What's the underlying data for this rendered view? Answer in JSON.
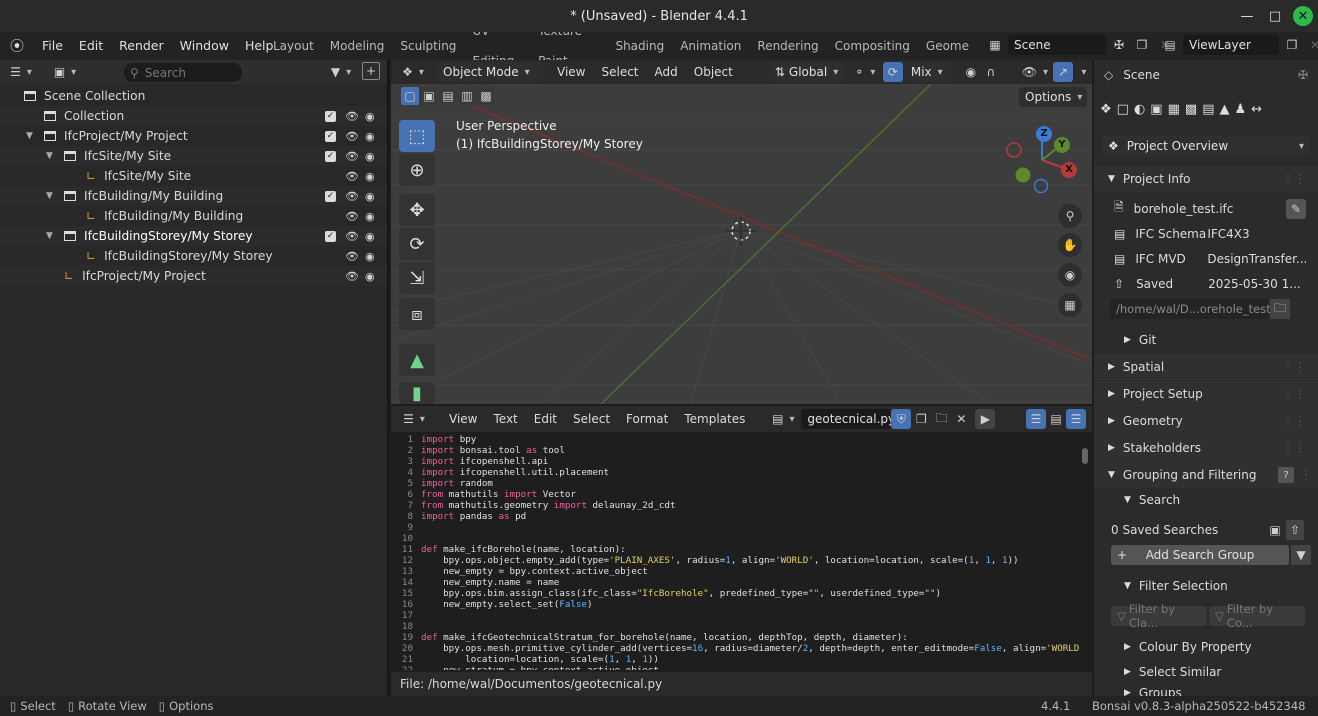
{
  "window": {
    "title": "* (Unsaved) - Blender 4.4.1"
  },
  "menu": [
    "File",
    "Edit",
    "Render",
    "Window",
    "Help"
  ],
  "workspaces": [
    "Layout",
    "Modeling",
    "Sculpting",
    "UV Editing",
    "Texture Paint",
    "Shading",
    "Animation",
    "Rendering",
    "Compositing",
    "Geome"
  ],
  "scene_name": "Scene",
  "view_layer": "ViewLayer",
  "outliner": {
    "search_placeholder": "Search",
    "rows": [
      {
        "label": "Scene Collection"
      },
      {
        "label": "Collection"
      },
      {
        "label": "IfcProject/My Project"
      },
      {
        "label": "IfcSite/My Site"
      },
      {
        "label": "IfcSite/My Site"
      },
      {
        "label": "IfcBuilding/My Building"
      },
      {
        "label": "IfcBuilding/My Building"
      },
      {
        "label": "IfcBuildingStorey/My Storey"
      },
      {
        "label": "IfcBuildingStorey/My Storey"
      },
      {
        "label": "IfcProject/My Project"
      }
    ]
  },
  "viewport": {
    "mode": "Object Mode",
    "menus": [
      "View",
      "Select",
      "Add",
      "Object"
    ],
    "orientation": "Global",
    "shading": "Mix",
    "options": "Options",
    "perspective": "User Perspective",
    "collection_info": "(1) IfcBuildingStorey/My Storey",
    "axes": {
      "x": "X",
      "y": "Y",
      "z": "Z"
    }
  },
  "text_editor": {
    "menus": [
      "View",
      "Text",
      "Edit",
      "Select",
      "Format",
      "Templates"
    ],
    "filename": "geotecnical.py",
    "footer": "File: /home/wal/Documentos/geotecnical.py",
    "line_numbers": [
      "1",
      "2",
      "3",
      "4",
      "5",
      "6",
      "7",
      "8",
      "9",
      "10",
      "11",
      "12",
      "13",
      "14",
      "15",
      "16",
      "17",
      "18",
      "19",
      "20",
      "21",
      "22"
    ],
    "lines": [
      "import bpy",
      "import bonsai.tool as tool",
      "import ifcopenshell.api",
      "import ifcopenshell.util.placement",
      "import random",
      "from mathutils import Vector",
      "from mathutils.geometry import delaunay_2d_cdt",
      "import pandas as pd",
      "",
      "",
      "def make_ifcBorehole(name, location):",
      "    bpy.ops.object.empty_add(type='PLAIN_AXES', radius=1, align='WORLD', location=location, scale=(1, 1, 1))",
      "    new_empty = bpy.context.active_object",
      "    new_empty.name = name",
      "    bpy.ops.bim.assign_class(ifc_class=\"IfcBorehole\", predefined_type=\"\", userdefined_type=\"\")",
      "    new_empty.select_set(False)",
      "",
      "",
      "def make_ifcGeotechnicalStratum_for_borehole(name, location, depthTop, depth, diameter):",
      "    bpy.ops.mesh.primitive_cylinder_add(vertices=16, radius=diameter/2, depth=depth, enter_editmode=False, align='WORLD',",
      "        location=location, scale=(1, 1, 1))",
      "    new_stratum = bpy.context.active_object"
    ]
  },
  "properties": {
    "scene_label": "Scene",
    "overview": "Project Overview",
    "project_info": "Project Info",
    "file_name": "borehole_test.ifc",
    "schema_label": "IFC Schema",
    "schema_value": "IFC4X3",
    "mvd_label": "IFC MVD",
    "mvd_value": "DesignTransfer...",
    "saved_label": "Saved",
    "saved_value": "2025-05-30 1...",
    "path": "/home/wal/D...orehole_test.ifc",
    "git": "Git",
    "spatial": "Spatial",
    "project_setup": "Project Setup",
    "geometry": "Geometry",
    "stakeholders": "Stakeholders",
    "grouping": "Grouping and Filtering",
    "search": "Search",
    "saved_searches": "0 Saved Searches",
    "add_search_group": "Add Search Group",
    "filter_selection": "Filter Selection",
    "filter_class": "Filter by Cla...",
    "filter_co": "Filter by Co...",
    "colour_by_property": "Colour By Property",
    "select_similar": "Select Similar",
    "groups_partial": "Groups"
  },
  "status": {
    "select": "Select",
    "rotate": "Rotate View",
    "options": "Options",
    "version": "4.4.1",
    "bonsai": "Bonsai v0.8.3-alpha250522-b452348"
  },
  "colors": {
    "accent": "#4772b3",
    "x_axis": "#b63a3a",
    "y_axis": "#5a8a2c",
    "z_axis": "#3a7bd5"
  }
}
